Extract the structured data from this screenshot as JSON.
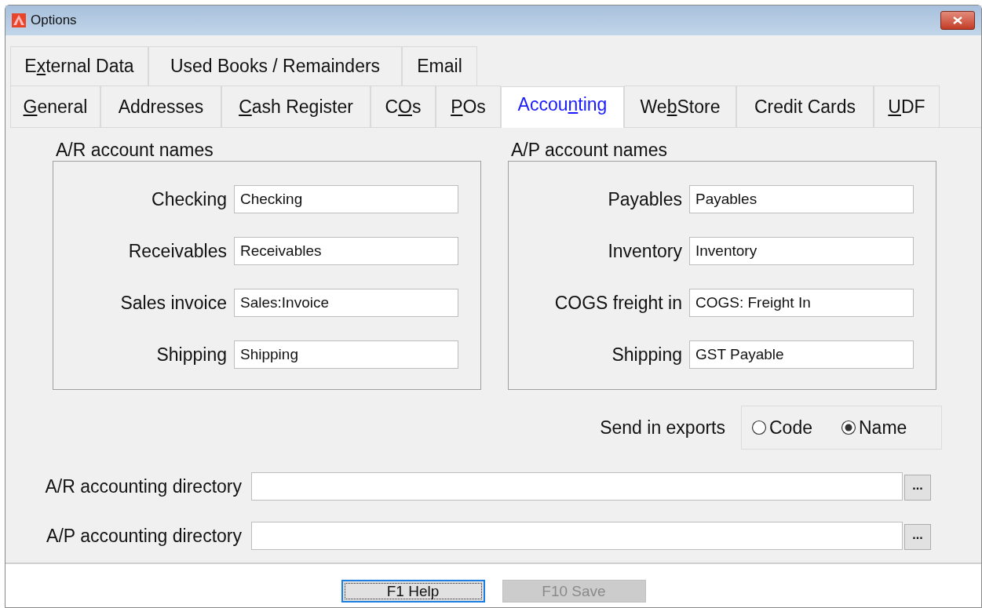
{
  "window": {
    "title": "Options"
  },
  "tab_rows": [
    [
      {
        "label": {
          "before": "E",
          "access_key": "x",
          "after": "ternal Data"
        },
        "selected": false
      },
      {
        "label": {
          "before": "Used Books / Remainders"
        },
        "selected": false
      },
      {
        "label": {
          "before": "Email"
        },
        "selected": false
      }
    ],
    [
      {
        "label": {
          "access_key": "G",
          "after": "eneral"
        },
        "selected": false
      },
      {
        "label": {
          "before": "Addresses"
        },
        "selected": false
      },
      {
        "label": {
          "access_key": "C",
          "after": "ash Register"
        },
        "selected": false
      },
      {
        "label": {
          "before": "C",
          "access_key": "O",
          "after": "s"
        },
        "selected": false
      },
      {
        "label": {
          "access_key": "P",
          "after": "Os"
        },
        "selected": false
      },
      {
        "label": {
          "before": "Accou",
          "access_key": "n",
          "after": "ting"
        },
        "selected": true
      },
      {
        "label": {
          "before": "We",
          "access_key": "b",
          "after": "Store"
        },
        "selected": false
      },
      {
        "label": {
          "before": "Credit Cards"
        },
        "selected": false
      },
      {
        "label": {
          "access_key": "U",
          "after": "DF"
        },
        "selected": false
      }
    ]
  ],
  "groups": [
    {
      "title": "A/R account names",
      "fields": [
        {
          "label": "Checking",
          "value": "Checking"
        },
        {
          "label": "Receivables",
          "value": "Receivables"
        },
        {
          "label": "Sales invoice",
          "value": "Sales:Invoice"
        },
        {
          "label": "Shipping",
          "value": "Shipping"
        }
      ]
    },
    {
      "title": "A/P account names",
      "fields": [
        {
          "label": "Payables",
          "value": "Payables"
        },
        {
          "label": "Inventory",
          "value": "Inventory"
        },
        {
          "label": "COGS freight in",
          "value": "COGS: Freight In"
        },
        {
          "label": "Shipping",
          "value": "GST Payable"
        }
      ]
    }
  ],
  "send_in_exports": {
    "label": "Send in exports",
    "options": [
      {
        "label": "Code",
        "selected": false
      },
      {
        "label": "Name",
        "selected": true
      }
    ]
  },
  "directories": [
    {
      "label": "A/R accounting directory",
      "browse": "..."
    },
    {
      "label": "A/P accounting directory",
      "browse": "..."
    }
  ],
  "buttons": [
    {
      "label": "F1 Help",
      "disabled": false,
      "focused": true
    },
    {
      "label": "F10 Save",
      "disabled": true,
      "focused": false
    }
  ]
}
